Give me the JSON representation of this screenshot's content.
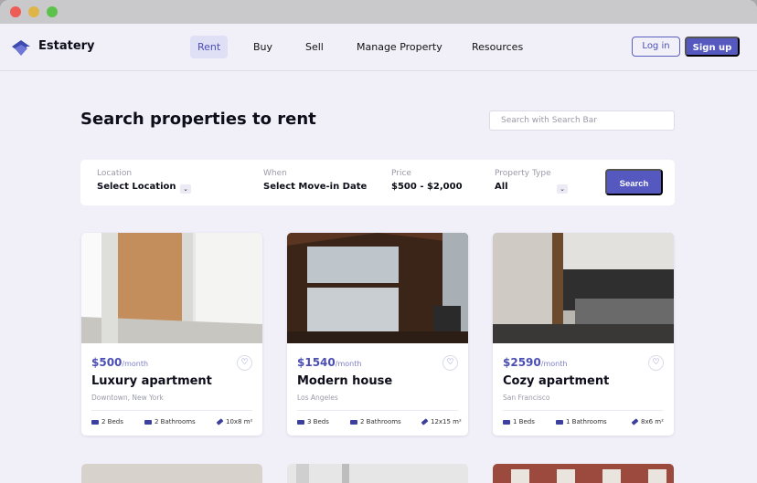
{
  "brand": {
    "name": "Estatery"
  },
  "nav": {
    "items": [
      {
        "label": "Rent",
        "active": true
      },
      {
        "label": "Buy",
        "active": false
      },
      {
        "label": "Sell",
        "active": false
      },
      {
        "label": "Manage Property",
        "active": false
      },
      {
        "label": "Resources",
        "active": false
      }
    ],
    "login_label": "Log in",
    "signup_label": "Sign up"
  },
  "page": {
    "title": "Search properties to rent",
    "search_placeholder": "Search with Search Bar"
  },
  "filters": {
    "location": {
      "label": "Location",
      "value": "Select Location"
    },
    "when": {
      "label": "When",
      "value": "Select Move-in Date"
    },
    "price": {
      "label": "Price",
      "value": "$500 - $2,000"
    },
    "type": {
      "label": "Property Type",
      "value": "All"
    },
    "search_label": "Search"
  },
  "listings": [
    {
      "price": "$500",
      "per": "/month",
      "title": "Luxury apartment",
      "location": "Downtown, New York",
      "beds": "2 Beds",
      "baths": "2 Bathrooms",
      "area": "10x8 m²"
    },
    {
      "price": "$1540",
      "per": "/month",
      "title": "Modern house",
      "location": "Los Angeles",
      "beds": "3 Beds",
      "baths": "2 Bathrooms",
      "area": "12x15 m²"
    },
    {
      "price": "$2590",
      "per": "/month",
      "title": "Cozy apartment",
      "location": "San Francisco",
      "beds": "1 Beds",
      "baths": "1 Bathrooms",
      "area": "8x6 m²"
    }
  ],
  "colors": {
    "accent": "#5458bf",
    "background": "#f1f0f9"
  }
}
